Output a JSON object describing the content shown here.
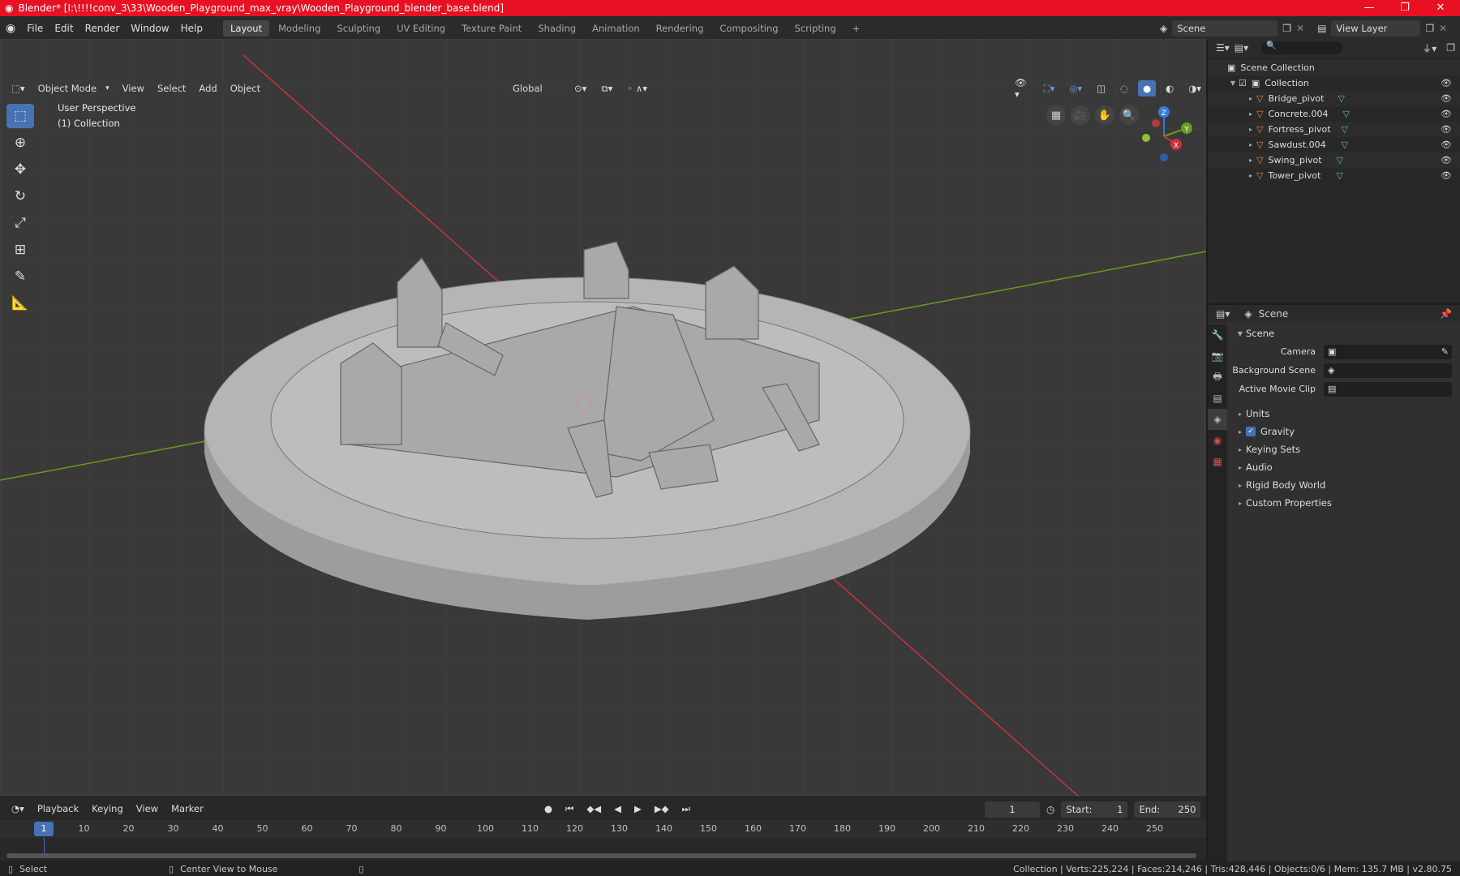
{
  "titlebar": {
    "title": "Blender* [I:\\!!!!conv_3\\33\\Wooden_Playground_max_vray\\Wooden_Playground_blender_base.blend]"
  },
  "menu": [
    "File",
    "Edit",
    "Render",
    "Window",
    "Help"
  ],
  "workspaces": [
    "Layout",
    "Modeling",
    "Sculpting",
    "UV Editing",
    "Texture Paint",
    "Shading",
    "Animation",
    "Rendering",
    "Compositing",
    "Scripting"
  ],
  "scene": {
    "label": "Scene",
    "view_layer": "View Layer"
  },
  "viewport_header": {
    "mode": "Object Mode",
    "view": "View",
    "select": "Select",
    "add": "Add",
    "object": "Object",
    "transform": "Global"
  },
  "viewport": {
    "perspective": "User Perspective",
    "collection": "(1) Collection"
  },
  "outliner": {
    "scene_collection": "Scene Collection",
    "collection": "Collection",
    "items": [
      "Bridge_pivot",
      "Concrete.004",
      "Fortress_pivot",
      "Sawdust.004",
      "Swing_pivot",
      "Tower_pivot"
    ]
  },
  "properties": {
    "header": "Scene",
    "section": "Scene",
    "camera": "Camera",
    "background_scene": "Background Scene",
    "active_movie_clip": "Active Movie Clip",
    "subsections": [
      "Units",
      "Gravity",
      "Keying Sets",
      "Audio",
      "Rigid Body World",
      "Custom Properties"
    ]
  },
  "timeline": {
    "playback": "Playback",
    "keying": "Keying",
    "view": "View",
    "marker": "Marker",
    "current_frame": "1",
    "start_label": "Start:",
    "start": "1",
    "end_label": "End:",
    "end": "250",
    "ticks": [
      "1",
      "10",
      "20",
      "30",
      "40",
      "50",
      "60",
      "70",
      "80",
      "90",
      "100",
      "110",
      "120",
      "130",
      "140",
      "150",
      "160",
      "170",
      "180",
      "190",
      "200",
      "210",
      "220",
      "230",
      "240",
      "250"
    ]
  },
  "statusbar": {
    "select": "Select",
    "center": "Center View to Mouse",
    "stats": "Collection | Verts:225,224 | Faces:214,246 | Tris:428,446 | Objects:0/6 | Mem: 135.7 MB | v2.80.75"
  },
  "gizmo": {
    "x": "X",
    "y": "Y",
    "z": "Z"
  },
  "colors": {
    "title": "#e81123",
    "accent": "#4772b3",
    "x_axis": "#c9323c",
    "y_axis": "#6a9a23",
    "z_axis": "#3b79d6"
  }
}
